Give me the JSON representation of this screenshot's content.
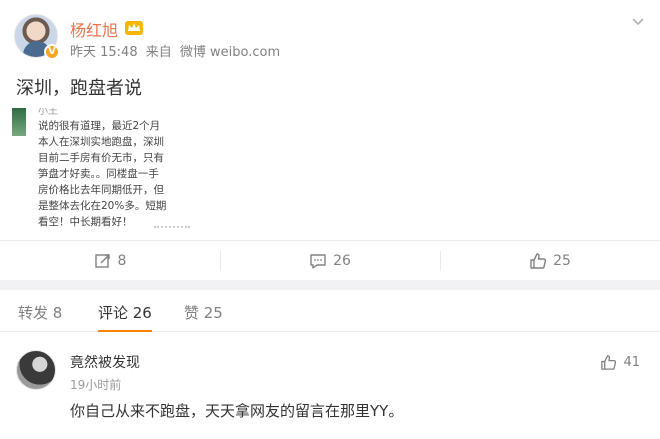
{
  "post": {
    "username": "杨红旭",
    "time": "昨天 15:48",
    "source_prefix": "来自",
    "source": "微博 weibo.com",
    "text": "深圳，跑盘者说",
    "image": {
      "name": "小王",
      "lines": [
        "说的很有道理，最近2个月",
        "本人在深圳实地跑盘，深圳",
        "目前二手房有价无市，只有",
        "笋盘才好卖。。同楼盘一手",
        "房价格比去年同期低开，但",
        "是整体去化在20%多。短期",
        "看空！中长期看好！"
      ]
    },
    "actions": {
      "repost_count": "8",
      "comment_count": "26",
      "like_count": "25"
    }
  },
  "tabs": [
    {
      "label": "转发 8"
    },
    {
      "label": "评论 26"
    },
    {
      "label": "赞 25"
    }
  ],
  "comment": {
    "username": "竟然被发现",
    "time": "19小时前",
    "text": "你自己从来不跑盘，天天拿网友的留言在那里YY。",
    "likes": "41"
  },
  "colors": {
    "username": "#eb7350",
    "active_tab_underline": "#ff8200",
    "muted": "#808080",
    "background": "#f2f2f5"
  },
  "icons": [
    "verified-badge-icon",
    "vip-crown-icon",
    "chevron-down-icon",
    "repost-icon",
    "comment-icon",
    "like-icon"
  ]
}
